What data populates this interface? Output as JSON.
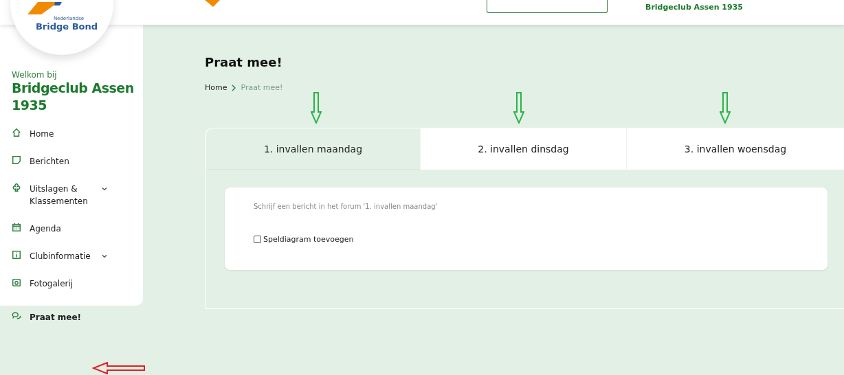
{
  "logo": {
    "subtitle": "Nederlandse",
    "title": "Bridge Bond"
  },
  "header": {
    "club_name": "Bridgeclub Assen 1935"
  },
  "sidebar": {
    "welcome": "Welkom bij",
    "club": "Bridgeclub Assen 1935",
    "items": [
      {
        "label": "Home",
        "kind": "home",
        "expandable": false,
        "selected": false
      },
      {
        "label": "Berichten",
        "kind": "note",
        "expandable": false,
        "selected": false
      },
      {
        "label": "Uitslagen & Klassementen",
        "kind": "club",
        "expandable": true,
        "selected": false
      },
      {
        "label": "Agenda",
        "kind": "calendar",
        "expandable": false,
        "selected": false
      },
      {
        "label": "Clubinformatie",
        "kind": "info",
        "expandable": true,
        "selected": false
      },
      {
        "label": "Fotogalerij",
        "kind": "camera",
        "expandable": false,
        "selected": false
      },
      {
        "label": "Praat mee!",
        "kind": "chat",
        "expandable": false,
        "selected": true
      }
    ]
  },
  "page": {
    "title": "Praat mee!",
    "breadcrumb": [
      {
        "label": "Home",
        "current": false
      },
      {
        "label": "Praat mee!",
        "current": true
      }
    ]
  },
  "tabs": [
    {
      "label": "1. invallen maandag",
      "selected": true
    },
    {
      "label": "2. invallen dinsdag",
      "selected": false
    },
    {
      "label": "3. invallen woensdag",
      "selected": false
    }
  ],
  "forum": {
    "placeholder": "Schrijf een bericht in het forum '1. invallen maandag'",
    "option": {
      "label": "Speldiagram toevoegen",
      "checked": false
    }
  }
}
